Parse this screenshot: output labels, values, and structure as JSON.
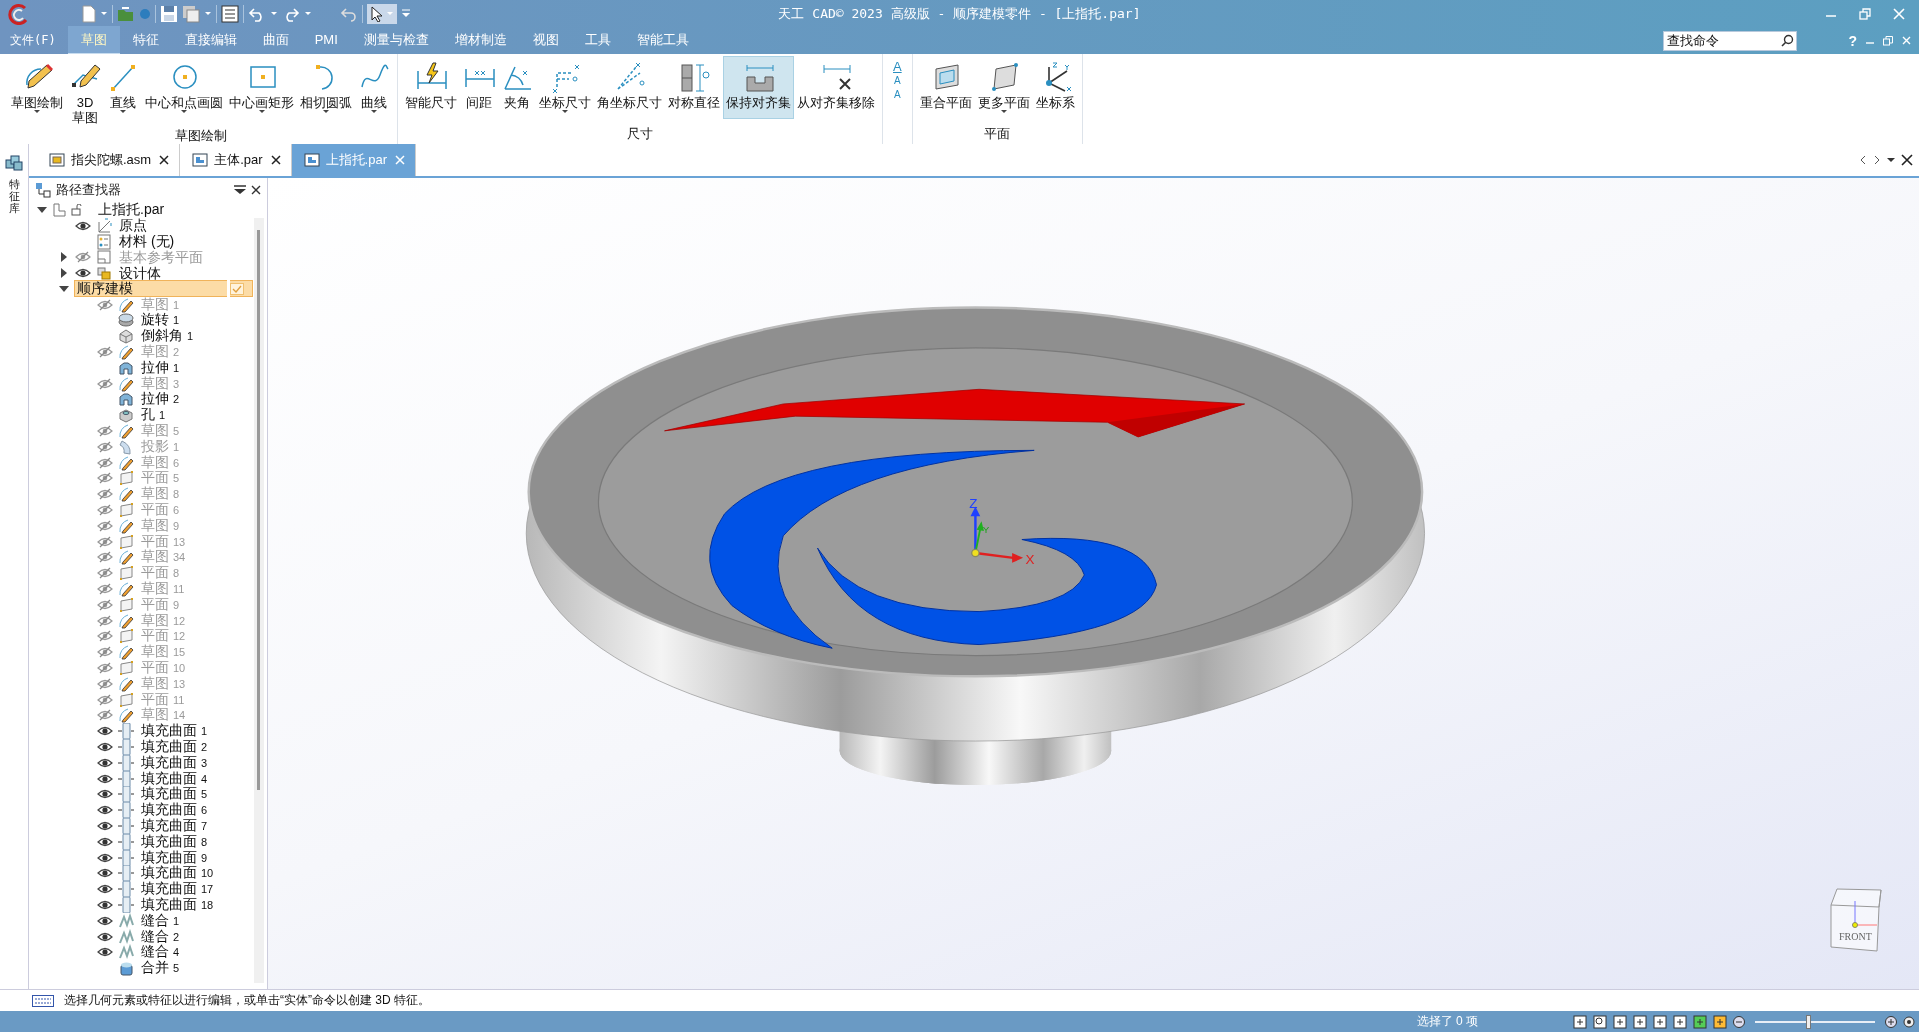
{
  "title_bar": {
    "title": "天工 CAD© 2023 高级版 - 顺序建模零件 - [上指托.par]"
  },
  "menu": {
    "file": "文件(F)",
    "tabs": [
      {
        "label": "草图",
        "selected": true
      },
      {
        "label": "特征",
        "selected": false
      },
      {
        "label": "直接编辑",
        "selected": false
      },
      {
        "label": "曲面",
        "selected": false
      },
      {
        "label": "PMI",
        "selected": false
      },
      {
        "label": "测量与检查",
        "selected": false
      },
      {
        "label": "增材制造",
        "selected": false
      },
      {
        "label": "视图",
        "selected": false
      },
      {
        "label": "工具",
        "selected": false
      },
      {
        "label": "智能工具",
        "selected": false
      }
    ],
    "search": {
      "placeholder": "查找命令"
    },
    "help": "?"
  },
  "ribbon": {
    "groups": [
      {
        "label": "草图绘制",
        "commands": [
          {
            "label": "草图绘制",
            "dropdown": true,
            "selected": false
          },
          {
            "label": "3D 草图",
            "dropdown": false,
            "selected": false
          },
          {
            "label": "直线",
            "dropdown": true,
            "selected": false
          },
          {
            "label": "中心和点画圆",
            "dropdown": true,
            "selected": false
          },
          {
            "label": "中心画矩形",
            "dropdown": true,
            "selected": false
          },
          {
            "label": "相切圆弧",
            "dropdown": true,
            "selected": false
          },
          {
            "label": "曲线",
            "dropdown": true,
            "selected": false
          }
        ]
      },
      {
        "label": "尺寸",
        "commands": [
          {
            "label": "智能尺寸",
            "dropdown": false,
            "selected": false
          },
          {
            "label": "间距",
            "dropdown": false,
            "selected": false
          },
          {
            "label": "夹角",
            "dropdown": false,
            "selected": false
          },
          {
            "label": "坐标尺寸",
            "dropdown": true,
            "selected": false
          },
          {
            "label": "角坐标尺寸",
            "dropdown": false,
            "selected": false
          },
          {
            "label": "对称直径",
            "dropdown": false,
            "selected": false
          },
          {
            "label": "保持对齐集",
            "dropdown": false,
            "selected": true
          },
          {
            "label": "从对齐集移除",
            "dropdown": false,
            "selected": false
          }
        ],
        "text_style": [
          "A",
          "A",
          "A"
        ]
      },
      {
        "label": "平面",
        "commands": [
          {
            "label": "重合平面",
            "dropdown": false,
            "selected": false
          },
          {
            "label": "更多平面",
            "dropdown": true,
            "selected": false
          },
          {
            "label": "坐标系",
            "dropdown": false,
            "selected": false
          }
        ]
      }
    ]
  },
  "side_strip": {
    "label": "特征库"
  },
  "document_tabs": [
    {
      "label": "指尖陀螺.asm",
      "kind": "assembly",
      "selected": false
    },
    {
      "label": "主体.par",
      "kind": "part",
      "selected": false
    },
    {
      "label": "上指托.par",
      "kind": "part",
      "selected": true
    }
  ],
  "path_finder": {
    "title": "路径查找器",
    "root": {
      "label": "上指托.par",
      "kind": "part",
      "expanded": true,
      "selected": false,
      "children": [
        {
          "label": "原点",
          "kind": "origin",
          "visible": true,
          "selected": false
        },
        {
          "label": "材料 (无)",
          "kind": "material",
          "selected": false
        },
        {
          "label": "基本参考平面",
          "kind": "ref_planes",
          "visible": false,
          "expanded": false,
          "selected": false
        },
        {
          "label": "设计体",
          "kind": "body",
          "visible": true,
          "expanded": false,
          "selected": false
        },
        {
          "label": "顺序建模",
          "kind": "group",
          "expanded": true,
          "selected": true,
          "children": [
            {
              "label": "草图",
              "number": "1",
              "kind": "sketch",
              "visible": false,
              "selected": false
            },
            {
              "label": "旋转",
              "number": "1",
              "kind": "revolve",
              "selected": false
            },
            {
              "label": "倒斜角",
              "number": "1",
              "kind": "chamfer",
              "selected": false
            },
            {
              "label": "草图",
              "number": "2",
              "kind": "sketch",
              "visible": false,
              "selected": false
            },
            {
              "label": "拉伸",
              "number": "1",
              "kind": "extrude",
              "selected": false
            },
            {
              "label": "草图",
              "number": "3",
              "kind": "sketch",
              "visible": false,
              "selected": false
            },
            {
              "label": "拉伸",
              "number": "2",
              "kind": "extrude",
              "selected": false
            },
            {
              "label": "孔",
              "number": "1",
              "kind": "hole",
              "selected": false
            },
            {
              "label": "草图",
              "number": "5",
              "kind": "sketch",
              "visible": false,
              "selected": false
            },
            {
              "label": "投影",
              "number": "1",
              "kind": "projection",
              "visible": false,
              "selected": false
            },
            {
              "label": "草图",
              "number": "6",
              "kind": "sketch",
              "visible": false,
              "selected": false
            },
            {
              "label": "平面",
              "number": "5",
              "kind": "plane",
              "visible": false,
              "selected": false
            },
            {
              "label": "草图",
              "number": "8",
              "kind": "sketch",
              "visible": false,
              "selected": false
            },
            {
              "label": "平面",
              "number": "6",
              "kind": "plane",
              "visible": false,
              "selected": false
            },
            {
              "label": "草图",
              "number": "9",
              "kind": "sketch",
              "visible": false,
              "selected": false
            },
            {
              "label": "平面",
              "number": "13",
              "kind": "plane",
              "visible": false,
              "selected": false
            },
            {
              "label": "草图",
              "number": "34",
              "kind": "sketch",
              "visible": false,
              "selected": false
            },
            {
              "label": "平面",
              "number": "8",
              "kind": "plane",
              "visible": false,
              "selected": false
            },
            {
              "label": "草图",
              "number": "11",
              "kind": "sketch",
              "visible": false,
              "selected": false
            },
            {
              "label": "平面",
              "number": "9",
              "kind": "plane",
              "visible": false,
              "selected": false
            },
            {
              "label": "草图",
              "number": "12",
              "kind": "sketch",
              "visible": false,
              "selected": false
            },
            {
              "label": "平面",
              "number": "12",
              "kind": "plane",
              "visible": false,
              "selected": false
            },
            {
              "label": "草图",
              "number": "15",
              "kind": "sketch",
              "visible": false,
              "selected": false
            },
            {
              "label": "平面",
              "number": "10",
              "kind": "plane",
              "visible": false,
              "selected": false
            },
            {
              "label": "草图",
              "number": "13",
              "kind": "sketch",
              "visible": false,
              "selected": false
            },
            {
              "label": "平面",
              "number": "11",
              "kind": "plane",
              "visible": false,
              "selected": false
            },
            {
              "label": "草图",
              "number": "14",
              "kind": "sketch",
              "visible": false,
              "selected": false
            },
            {
              "label": "填充曲面",
              "number": "1",
              "kind": "fill",
              "visible": true,
              "selected": false
            },
            {
              "label": "填充曲面",
              "number": "2",
              "kind": "fill",
              "visible": true,
              "selected": false
            },
            {
              "label": "填充曲面",
              "number": "3",
              "kind": "fill",
              "visible": true,
              "selected": false
            },
            {
              "label": "填充曲面",
              "number": "4",
              "kind": "fill",
              "visible": true,
              "selected": false
            },
            {
              "label": "填充曲面",
              "number": "5",
              "kind": "fill",
              "visible": true,
              "selected": false
            },
            {
              "label": "填充曲面",
              "number": "6",
              "kind": "fill",
              "visible": true,
              "selected": false
            },
            {
              "label": "填充曲面",
              "number": "7",
              "kind": "fill",
              "visible": true,
              "selected": false
            },
            {
              "label": "填充曲面",
              "number": "8",
              "kind": "fill",
              "visible": true,
              "selected": false
            },
            {
              "label": "填充曲面",
              "number": "9",
              "kind": "fill",
              "visible": true,
              "selected": false
            },
            {
              "label": "填充曲面",
              "number": "10",
              "kind": "fill",
              "visible": true,
              "selected": false
            },
            {
              "label": "填充曲面",
              "number": "17",
              "kind": "fill",
              "visible": true,
              "selected": false
            },
            {
              "label": "填充曲面",
              "number": "18",
              "kind": "fill",
              "visible": true,
              "selected": false
            },
            {
              "label": "缝合",
              "number": "1",
              "kind": "stitch",
              "visible": true,
              "selected": false
            },
            {
              "label": "缝合",
              "number": "2",
              "kind": "stitch",
              "visible": true,
              "selected": false
            },
            {
              "label": "缝合",
              "number": "4",
              "kind": "stitch",
              "visible": true,
              "selected": false
            },
            {
              "label": "合并",
              "number": "5",
              "kind": "union",
              "selected": false
            }
          ]
        }
      ]
    }
  },
  "viewport": {
    "axis_labels": [
      "Z",
      "Y",
      "X"
    ],
    "view_cube": {
      "face": "FRONT"
    }
  },
  "status_bar": {
    "message": "选择几何元素或特征以进行编辑，或单击“实体”命令以创建 3D 特征。",
    "selection": "选择了 0 项",
    "zoom": {
      "level": 0.45
    }
  }
}
